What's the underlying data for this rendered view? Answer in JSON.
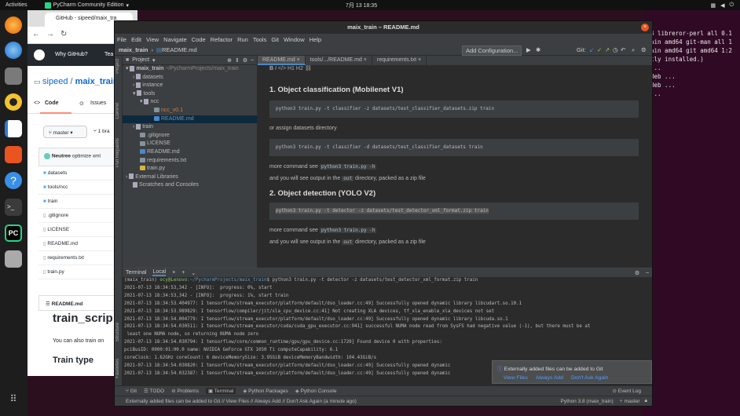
{
  "topbar": {
    "activities": "Activities",
    "app": "PyCharm Community Edition",
    "clock": "7月 13  18:35"
  },
  "bg_terminal": {
    "lines": [
      "4 libreror-perl all 0.1",
      "",
      "ain amd64 git-man all 1",
      "",
      "ain amd64 git amd64 1:2",
      "",
      "",
      "",
      "tly installed.)",
      "...",
      "",
      "deb ...",
      "",
      "",
      "deb ...",
      "..."
    ]
  },
  "browser": {
    "tab_title": "GitHub - sipeed/maix_tra",
    "nav_why": "Why GitHub?",
    "nav_team": "Tea",
    "repo_owner": "sipeed",
    "repo_sep": "/",
    "repo_name": "maix_train",
    "tab_code": "Code",
    "tab_issues": "Issues",
    "branch": "master",
    "branches_count": "1",
    "branches_label": "bra",
    "commit_author": "Neutree",
    "commit_msg": "optimize xml",
    "files": [
      "datasets",
      "tools/ncc",
      "train",
      ".gitignore",
      "LICENSE",
      "README.md",
      "requirements.txt",
      "train.py"
    ],
    "readme_label": "README.md",
    "readme_title": "train_scrip",
    "readme_text": "You can also train on",
    "readme_h2": "Train type"
  },
  "ide": {
    "title": "maix_train – README.md",
    "menu": [
      "File",
      "Edit",
      "View",
      "Navigate",
      "Code",
      "Refactor",
      "Run",
      "Tools",
      "Git",
      "Window",
      "Help"
    ],
    "breadcrumb": [
      "maix_train",
      "README.md"
    ],
    "add_config": "Add Configuration...",
    "git_label": "Git:",
    "project_label": "Project",
    "tree": [
      {
        "label": "maix_train",
        "path": "~/PycharmProjects/maix_train",
        "depth": 0,
        "type": "dir"
      },
      {
        "label": "datasets",
        "depth": 1,
        "type": "dir"
      },
      {
        "label": "instance",
        "depth": 1,
        "type": "dir"
      },
      {
        "label": "tools",
        "depth": 1,
        "type": "dir"
      },
      {
        "label": "ncc",
        "depth": 2,
        "type": "dir"
      },
      {
        "label": "ncc_v0.1",
        "depth": 3,
        "type": "file"
      },
      {
        "label": "README.md",
        "depth": 3,
        "type": "file",
        "selected": true
      },
      {
        "label": "train",
        "depth": 1,
        "type": "dir"
      },
      {
        "label": ".gitignore",
        "depth": 1,
        "type": "file"
      },
      {
        "label": "LICENSE",
        "depth": 1,
        "type": "file"
      },
      {
        "label": "README.md",
        "depth": 1,
        "type": "file"
      },
      {
        "label": "requirements.txt",
        "depth": 1,
        "type": "file"
      },
      {
        "label": "train.py",
        "depth": 1,
        "type": "file"
      },
      {
        "label": "External Libraries",
        "depth": 0,
        "type": "dir"
      },
      {
        "label": "Scratches and Consoles",
        "depth": 0,
        "type": "dir"
      }
    ],
    "editor_tabs": [
      "README.md",
      "tools/.../README.md",
      "requirements.txt"
    ],
    "md": {
      "h1": "1. Object classification (Mobilenet V1)",
      "code1": "python3 train.py -t classifier -z datasets/test_classifier_datasets.zip train",
      "or_assign": "or assign datasets directory",
      "code2": "python3 train.py -t classifier -d datasets/test_classifier_datasets train",
      "more_see": "more command see",
      "more_cmd": "python3 train.py -h",
      "output_a": "and you will see output in the",
      "output_dir": "out",
      "output_b": "directory, packed as a zip file",
      "h2": "2. Object detection (YOLO V2)",
      "code3": "python3 train.py -t detector -z datasets/test_detector_xml_format.zip train"
    },
    "terminal": {
      "label": "Terminal",
      "tab": "Local",
      "prompt_user": "(maix_train) ",
      "prompt_host": "ocy@Lenovo",
      "prompt_path": ":~/PycharmProjects/maix_train",
      "command": "$ python3 train.py -t detector -z datasets/test_detector_xml_format.zip train",
      "lines": [
        "2021-07-13 18:34:53,342 - [INFO]:  progress: 0%, start",
        "2021-07-13 18:34:53,342 - [INFO]:  progress: 1%, start train",
        "2021-07-13 18:34:53.404977: I tensorflow/stream_executor/platform/default/dso_loader.cc:49] Successfully opened dynamic library libcudart.so.10.1",
        "2021-07-13 18:34:53.989829: I tensorflow/compiler/jit/xla_cpu_device.cc:41] Not creating XLA devices, tf_xla_enable_xla_devices not set",
        "2021-07-13 18:34:54.004779: I tensorflow/stream_executor/platform/default/dso_loader.cc:49] Successfully opened dynamic library libcuda.so.1",
        "2021-07-13 18:34:54.030511: I tensorflow/stream_executor/cuda/cuda_gpu_executor.cc:941] successful NUMA node read from SysFS had negative value (-1), but there must be at",
        " least one NUMA node, so returning NUMA node zero",
        "2021-07-13 18:34:54.030794: I tensorflow/core/common_runtime/gpu/gpu_device.cc:1720] Found device 0 with properties:",
        "pciBusID: 0000:01:00.0 name: NVIDIA GeForce GTX 1050 Ti computeCapability: 6.1",
        "coreClock: 1.62GHz coreCount: 6 deviceMemorySize: 3.95GiB deviceMemoryBandwidth: 104.43GiB/s",
        "2021-07-13 18:34:54.030820: I tensorflow/stream_executor/platform/default/dso_loader.cc:49] Successfully opened dynamic",
        "2021-07-13 18:34:54.032387: I tensorflow/stream_executor/platform/default/dso_loader.cc:49] Successfully opened dynamic"
      ]
    },
    "tool_windows": [
      "Git",
      "TODO",
      "Problems",
      "Terminal",
      "Python Packages",
      "Python Console"
    ],
    "event_log": "Event Log",
    "status_msg": "Externally added files can be added to Git // View Files // Always Add // Don't Ask Again (a minute ago)",
    "status_right": [
      "Python 3.8 (maix_train)",
      "master"
    ],
    "notification": {
      "title": "Externally added files can be added to Git",
      "links": [
        "View Files",
        "Always Add",
        "Don't Ask Again"
      ]
    }
  },
  "colors": {
    "ubuntu_bg": "#2c0f1f",
    "terminal_bg": "#300a24",
    "ide_bg": "#3c3f41",
    "editor_bg": "#2b2b2b",
    "accent": "#4a88c7"
  }
}
